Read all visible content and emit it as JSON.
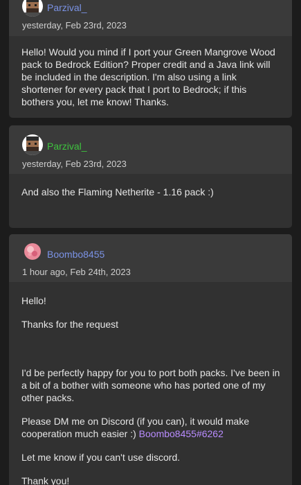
{
  "posts": [
    {
      "username": "Parzival_",
      "timestamp": "yesterday, Feb 23rd, 2023",
      "body": "Hello! Would you mind if I port your Green Mangrove Wood pack to Bedrock Edition? Proper credit and a Java link will be included in the description. I'm also using a link shortener for every pack that I port to Bedrock; if this bothers you, let me know! Thanks."
    },
    {
      "username": "Parzival_",
      "timestamp": "yesterday, Feb 23rd, 2023",
      "body": "And also the Flaming Netherite - 1.16 pack :)"
    },
    {
      "username": "Boombo8455",
      "timestamp": "1 hour ago, Feb 24th, 2023",
      "paragraphs": [
        "Hello!",
        "Thanks for the request",
        "I'd be perfectly happy for you to port both packs. I've been in a bit of a bother with someone who has ported one of my other packs.",
        "Please DM me on Discord (if you can), it would make cooperation much easier :)",
        "Let me know if you can't use discord.",
        "Thank you!"
      ],
      "discord_tag": "Boombo8455#6262"
    }
  ],
  "colors": {
    "username_blue": "#7b93e6",
    "username_green": "#3ec43e",
    "mention": "#b98cff"
  },
  "icons": [
    "pixel-avatar-icon",
    "pink-orb-avatar-icon"
  ]
}
